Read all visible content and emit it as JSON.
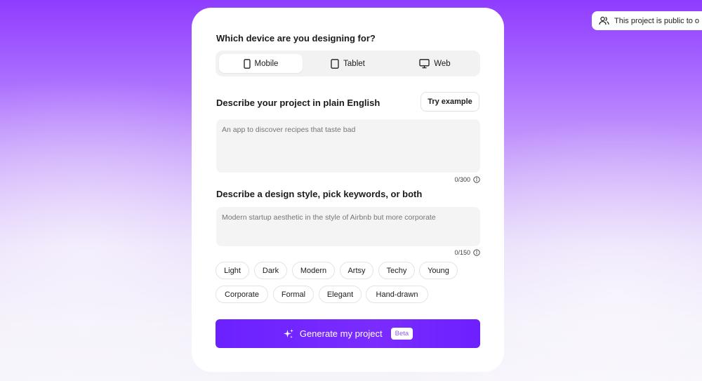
{
  "device_section": {
    "title": "Which device are you designing for?",
    "options": [
      {
        "label": "Mobile",
        "icon": "phone-icon",
        "active": true
      },
      {
        "label": "Tablet",
        "icon": "tablet-icon",
        "active": false
      },
      {
        "label": "Web",
        "icon": "monitor-icon",
        "active": false
      }
    ]
  },
  "project_section": {
    "title": "Describe your project in plain English",
    "try_example_label": "Try example",
    "placeholder": "An app to discover recipes that taste bad",
    "counter": "0/300"
  },
  "style_section": {
    "title": "Describe a design style, pick keywords, or both",
    "placeholder": "Modern startup aesthetic in the style of Airbnb but more corporate",
    "counter": "0/150",
    "keywords": [
      "Light",
      "Dark",
      "Modern",
      "Artsy",
      "Techy",
      "Young",
      "Corporate",
      "Formal",
      "Elegant",
      "Hand-drawn"
    ]
  },
  "generate": {
    "label": "Generate my project",
    "badge": "Beta",
    "icon": "sparkle-icon"
  },
  "visibility": {
    "text": "This project is public to o",
    "icon": "users-icon"
  },
  "colors": {
    "accent": "#6b21ff",
    "beta_text": "#8d5cf0"
  }
}
